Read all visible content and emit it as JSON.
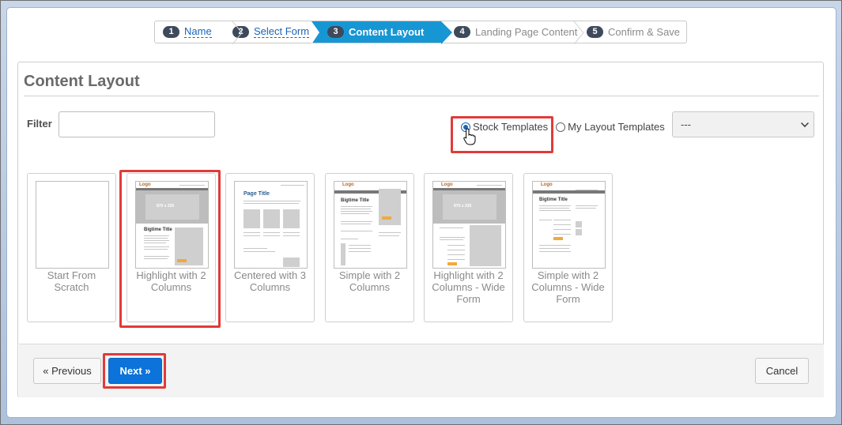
{
  "wizard": {
    "steps": [
      {
        "num": "1",
        "label": "Name",
        "state": "completed"
      },
      {
        "num": "2",
        "label": "Select Form",
        "state": "completed"
      },
      {
        "num": "3",
        "label": "Content Layout",
        "state": "active"
      },
      {
        "num": "4",
        "label": "Landing Page Content",
        "state": "pending"
      },
      {
        "num": "5",
        "label": "Confirm & Save",
        "state": "pending"
      }
    ]
  },
  "panel": {
    "title": "Content Layout",
    "filter_label": "Filter",
    "filter_value": "",
    "radio_options": [
      {
        "label": "Stock Templates",
        "selected": true
      },
      {
        "label": "My Layout Templates",
        "selected": false
      }
    ],
    "layout_select_value": "---"
  },
  "templates": [
    {
      "name": "Start From Scratch"
    },
    {
      "name": "Highlight with 2 Columns"
    },
    {
      "name": "Centered with 3 Columns"
    },
    {
      "name": "Simple with 2 Columns"
    },
    {
      "name": "Highlight with 2 Columns - Wide Form"
    },
    {
      "name": "Simple with 2 Columns - Wide Form"
    }
  ],
  "thumb_text": {
    "logo": "Logo",
    "image_size": "870 x 330",
    "page_title": "Page Title",
    "bigtime_title": "Bigtime Title"
  },
  "footer": {
    "previous_label": "« Previous",
    "next_label": "Next »",
    "cancel_label": "Cancel"
  },
  "colors": {
    "accent": "#1796d4",
    "primary_button": "#0b73d9",
    "highlight": "#e03b3b"
  }
}
